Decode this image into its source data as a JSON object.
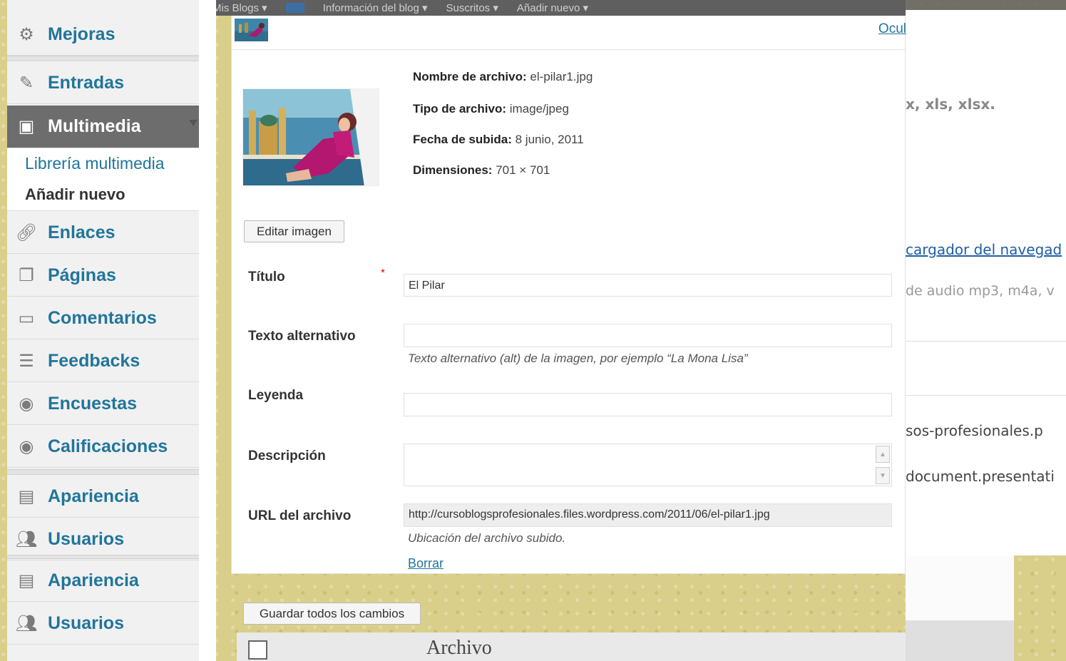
{
  "topbar": {
    "items": [
      "Mis Blogs ▾",
      "Información del blog ▾",
      "Suscritos ▾",
      "Añadir nuevo ▾"
    ]
  },
  "sidebar": {
    "items": [
      {
        "label": "Mejoras",
        "icon": "gear-icon"
      },
      {
        "label": "Entradas",
        "icon": "pushpin-icon"
      },
      {
        "label": "Multimedia",
        "icon": "media-icon"
      },
      {
        "label": "Enlaces",
        "icon": "link-icon"
      },
      {
        "label": "Páginas",
        "icon": "pages-icon"
      },
      {
        "label": "Comentarios",
        "icon": "comment-icon"
      },
      {
        "label": "Feedbacks",
        "icon": "feedback-icon"
      },
      {
        "label": "Encuestas",
        "icon": "poll-icon"
      },
      {
        "label": "Calificaciones",
        "icon": "rating-icon"
      },
      {
        "label": "Apariencia",
        "icon": "appearance-icon"
      },
      {
        "label": "Usuarios",
        "icon": "users-icon"
      },
      {
        "label": "Apariencia",
        "icon": "appearance-icon"
      },
      {
        "label": "Usuarios",
        "icon": "users-icon"
      }
    ],
    "submenu": {
      "library": "Librería multimedia",
      "add_new": "Añadir nuevo"
    }
  },
  "panel": {
    "hide_link": "Ocul",
    "meta": {
      "filename_label": "Nombre de archivo:",
      "filename": "el-pilar1.jpg",
      "filetype_label": "Tipo de archivo:",
      "filetype": "image/jpeg",
      "date_label": "Fecha de subida:",
      "date": "8 junio, 2011",
      "dims_label": "Dimensiones:",
      "dims": "701 × 701"
    },
    "edit_image_button": "Editar imagen",
    "fields": {
      "title_label": "Título",
      "title_value": "El Pilar",
      "required_mark": "*",
      "alt_label": "Texto alternativo",
      "alt_value": "",
      "alt_help": "Texto alternativo (alt) de la imagen, por ejemplo “La Mona Lisa”",
      "caption_label": "Leyenda",
      "caption_value": "",
      "desc_label": "Descripción",
      "url_label": "URL del archivo",
      "url_value": "http://cursoblogsprofesionales.files.wordpress.com/2011/06/el-pilar1.jpg",
      "url_help": "Ubicación del archivo subido."
    },
    "delete_link": "Borrar"
  },
  "save_all_button": "Guardar todos los cambios",
  "list": {
    "column_file": "Archivo"
  },
  "background": {
    "line1": "x, xls, xlsx.",
    "line2": "cargador del navegad",
    "line3": "de audio mp3, m4a, v",
    "line4": "sos-profesionales.p",
    "line5": "document.presentati"
  }
}
